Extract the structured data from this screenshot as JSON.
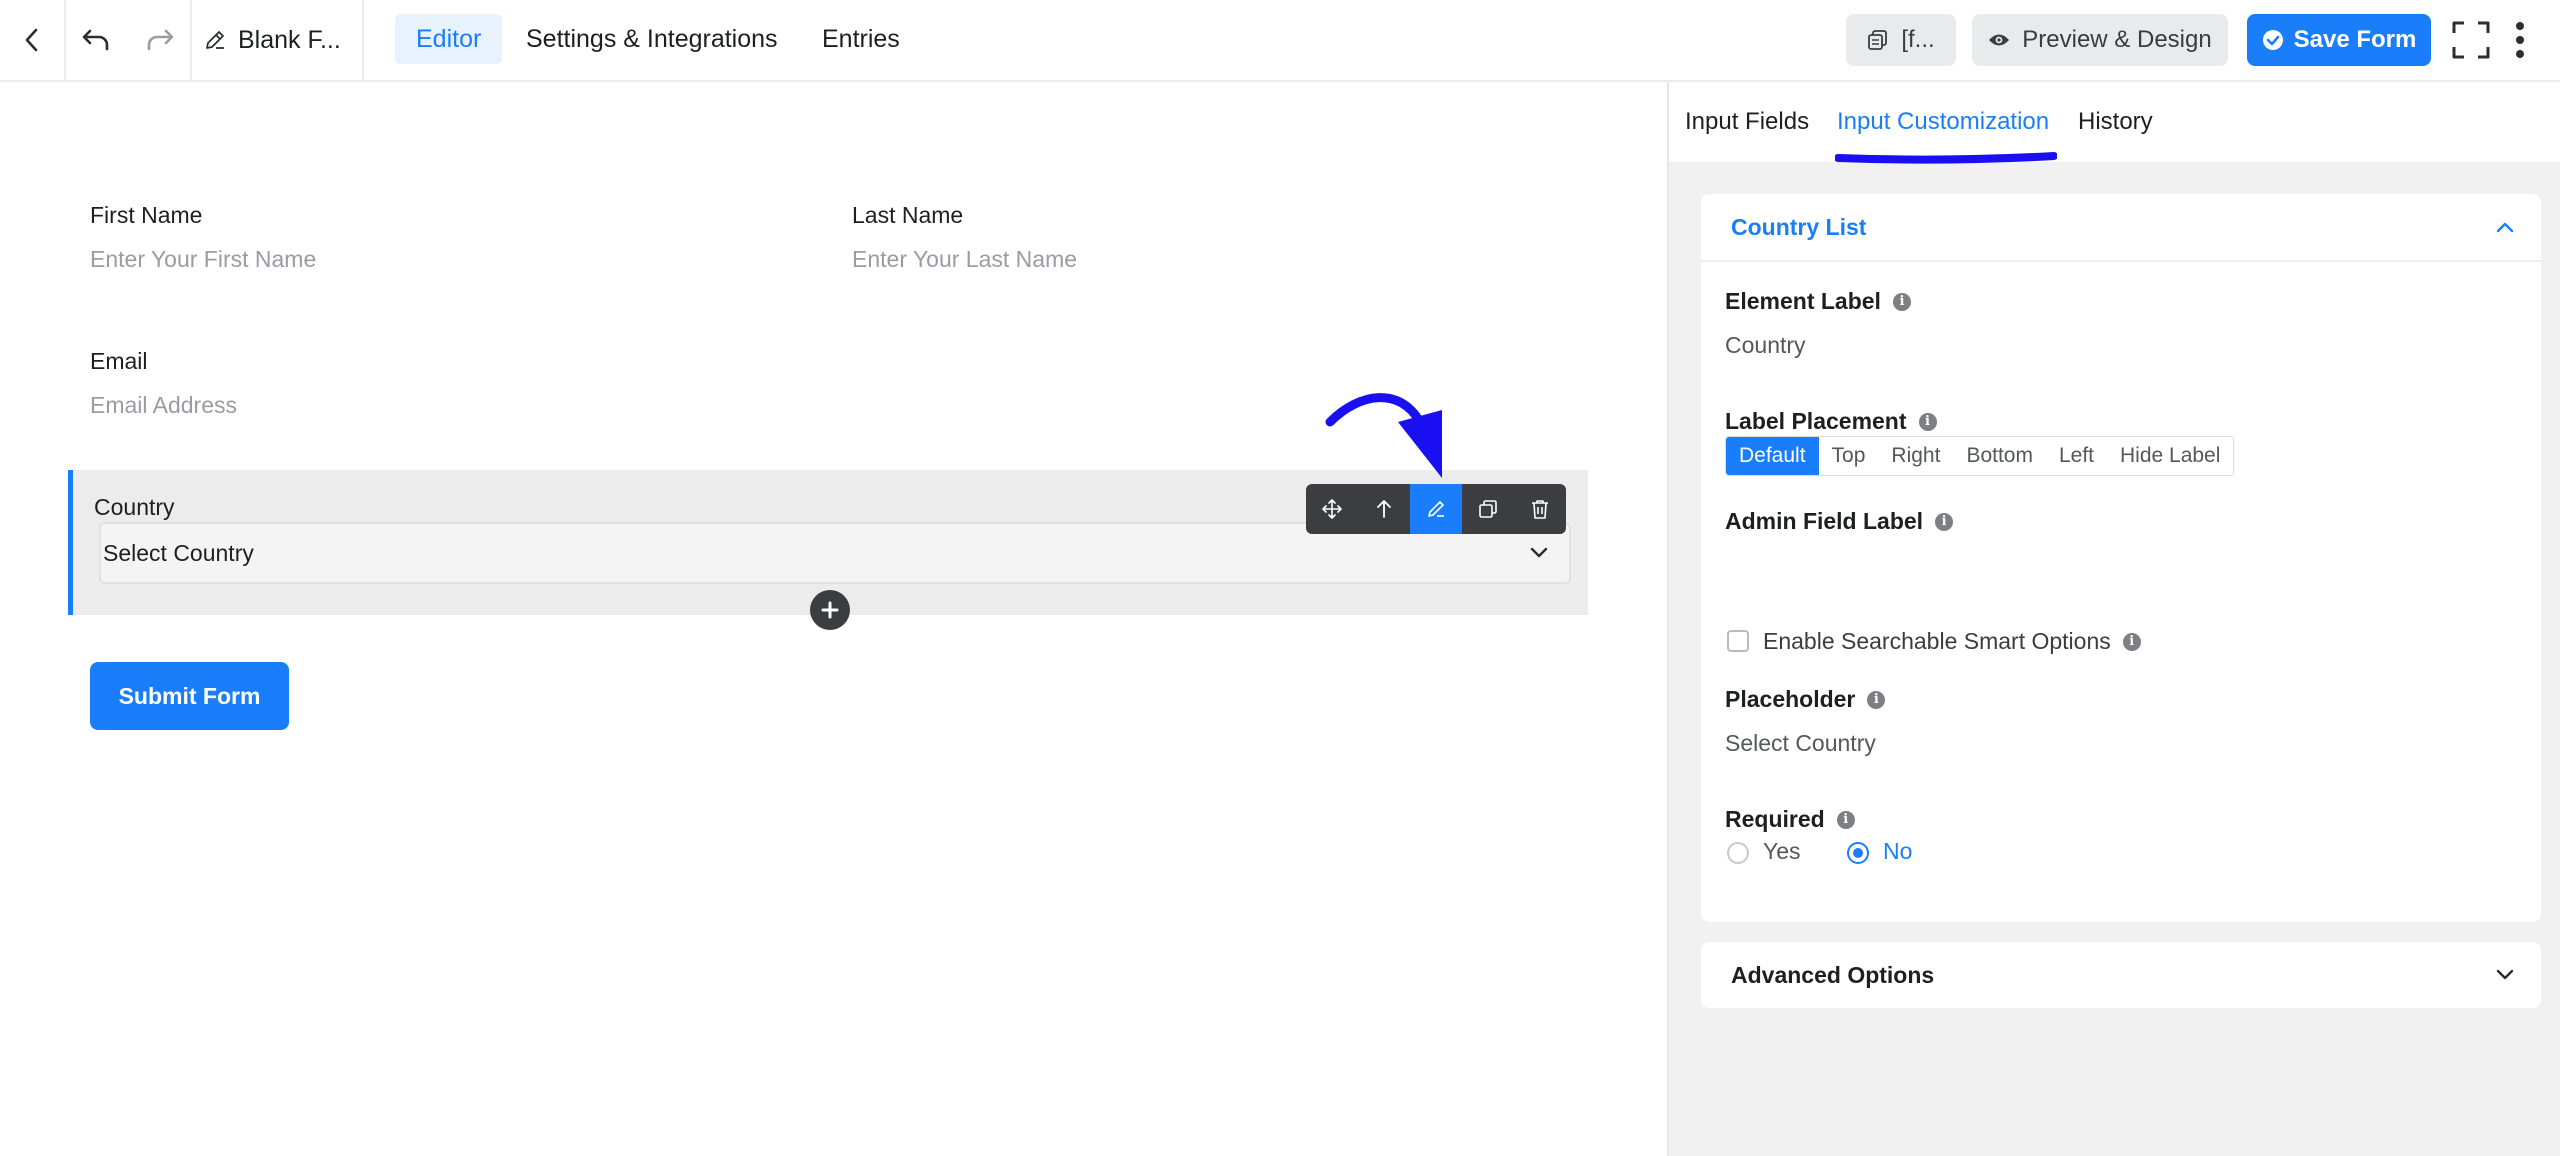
{
  "topbar": {
    "form_title": "Blank F...",
    "tabs": [
      {
        "label": "Editor",
        "active": true
      },
      {
        "label": "Settings & Integrations",
        "active": false
      },
      {
        "label": "Entries",
        "active": false
      }
    ],
    "shortcode_label": "[f...",
    "preview_label": "Preview & Design",
    "save_label": "Save Form"
  },
  "form": {
    "first_name": {
      "label": "First Name",
      "placeholder": "Enter Your First Name"
    },
    "last_name": {
      "label": "Last Name",
      "placeholder": "Enter Your Last Name"
    },
    "email": {
      "label": "Email",
      "placeholder": "Email Address"
    },
    "country": {
      "label": "Country",
      "placeholder": "Select Country"
    },
    "submit_label": "Submit Form"
  },
  "panel": {
    "tabs": [
      {
        "label": "Input Fields",
        "active": false
      },
      {
        "label": "Input Customization",
        "active": true
      },
      {
        "label": "History",
        "active": false
      }
    ],
    "section_title": "Country List",
    "element_label": {
      "label": "Element Label",
      "value": "Country"
    },
    "label_placement": {
      "label": "Label Placement",
      "options": [
        "Default",
        "Top",
        "Right",
        "Bottom",
        "Left",
        "Hide Label"
      ],
      "selected": "Default"
    },
    "admin_field_label": {
      "label": "Admin Field Label",
      "value": ""
    },
    "searchable": {
      "label": "Enable Searchable Smart Options",
      "checked": false
    },
    "placeholder": {
      "label": "Placeholder",
      "value": "Select Country"
    },
    "required": {
      "label": "Required",
      "yes": "Yes",
      "no": "No",
      "selected": "No"
    },
    "advanced_title": "Advanced Options"
  },
  "colors": {
    "accent": "#1a7efb",
    "annotation": "#1a0ff0",
    "toolbar": "#3b3d40",
    "panel_bg": "#f1f1f1"
  }
}
